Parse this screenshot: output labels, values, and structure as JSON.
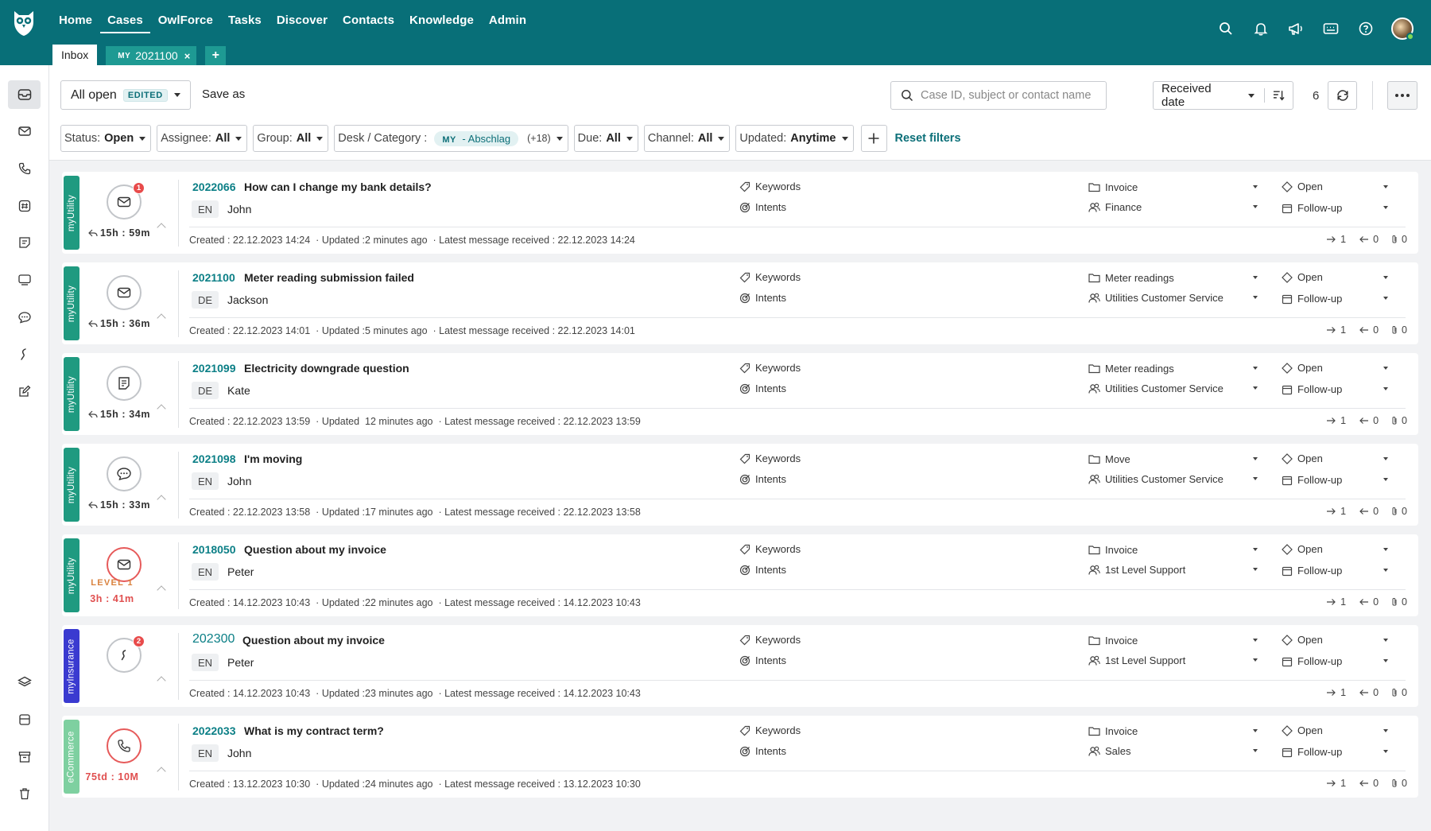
{
  "nav": [
    "Home",
    "Cases",
    "OwlForce",
    "Tasks",
    "Discover",
    "Contacts",
    "Knowledge",
    "Admin"
  ],
  "active_nav": "Cases",
  "tabs": {
    "inbox": "Inbox",
    "case_prefix": "MY",
    "case_id": "2021100",
    "close": "×",
    "add": "+"
  },
  "toolbar": {
    "view_name": "All open",
    "edited": "EDITED",
    "save_as": "Save as",
    "search_placeholder": "Case ID, subject or contact name",
    "sort_label": "Received date",
    "count": "6"
  },
  "filters": [
    {
      "label": "Status:",
      "value": "Open"
    },
    {
      "label": "Assignee:",
      "value": "All"
    },
    {
      "label": "Group:",
      "value": "All"
    },
    {
      "label": "Desk / Category :",
      "chip_prefix": "MY",
      "chip": " - Abschlag",
      "extra": "(+18)"
    },
    {
      "label": "Due:",
      "value": "All"
    },
    {
      "label": "Channel:",
      "value": "All"
    },
    {
      "label": "Updated:",
      "value": "Anytime"
    }
  ],
  "reset_filters": "Reset filters",
  "labels": {
    "keywords": "Keywords",
    "intents": "Intents",
    "created": "Created : ",
    "updated": "Updated",
    "latest": "Latest message received : "
  },
  "brand_colors": {
    "myUtility": "#1f9a80",
    "myInsurance": "#3a3ad0",
    "eCommerce": "#7ed0a0"
  },
  "cases": [
    {
      "brand": "myUtility",
      "channel": "email",
      "badge": "1",
      "sla": "15h : 59m",
      "sla_red": false,
      "level": "",
      "id": "2022066",
      "big": false,
      "subject": "How can I change my bank details?",
      "lang": "EN",
      "contact": "John",
      "category": "Invoice",
      "group": "Finance",
      "status": "Open",
      "followup": "Follow-up",
      "created": "22.12.2023 14:24",
      "updated": " :2 minutes ago",
      "latest": "22.12.2023 14:24",
      "out": "1",
      "in": "0",
      "att": "0"
    },
    {
      "brand": "myUtility",
      "channel": "email",
      "badge": "",
      "sla": "15h : 36m",
      "sla_red": false,
      "level": "",
      "id": "2021100",
      "big": false,
      "subject": "Meter reading submission failed",
      "lang": "DE",
      "contact": "Jackson",
      "category": "Meter readings",
      "group": "Utilities Customer Service",
      "status": "Open",
      "followup": "Follow-up",
      "created": "22.12.2023 14:01",
      "updated": " :5 minutes ago",
      "latest": "22.12.2023 14:01",
      "out": "1",
      "in": "0",
      "att": "0"
    },
    {
      "brand": "myUtility",
      "channel": "form",
      "badge": "",
      "sla": "15h : 34m",
      "sla_red": false,
      "level": "",
      "id": "2021099",
      "big": false,
      "subject": "Electricity downgrade question",
      "lang": "DE",
      "contact": "Kate",
      "category": "Meter readings",
      "group": "Utilities Customer Service",
      "status": "Open",
      "followup": "Follow-up",
      "created": "22.12.2023 13:59",
      "updated": "  12 minutes ago",
      "latest": "22.12.2023 13:59",
      "out": "1",
      "in": "0",
      "att": "0"
    },
    {
      "brand": "myUtility",
      "channel": "chat",
      "badge": "",
      "sla": "15h : 33m",
      "sla_red": false,
      "level": "",
      "id": "2021098",
      "big": false,
      "subject": "I'm moving",
      "lang": "EN",
      "contact": "John",
      "category": "Move",
      "group": "Utilities Customer Service",
      "status": "Open",
      "followup": "Follow-up",
      "created": "22.12.2023 13:58",
      "updated": " :17 minutes ago",
      "latest": "22.12.2023 13:58",
      "out": "1",
      "in": "0",
      "att": "0"
    },
    {
      "brand": "myUtility",
      "channel": "email",
      "badge": "",
      "sla": "3h : 41m",
      "sla_red": true,
      "level": "LEVEL 1",
      "id": "2018050",
      "big": false,
      "subject": "Question about my invoice",
      "lang": "EN",
      "contact": "Peter",
      "category": "Invoice",
      "group": "1st Level Support",
      "status": "Open",
      "followup": "Follow-up",
      "created": "14.12.2023 10:43",
      "updated": " :22 minutes ago",
      "latest": "14.12.2023 10:43",
      "out": "1",
      "in": "0",
      "att": "0"
    },
    {
      "brand": "myInsurance",
      "channel": "whatsapp",
      "badge": "2",
      "sla": "",
      "sla_red": false,
      "level": "",
      "id": "202300",
      "big": true,
      "subject": "Question about my invoice",
      "lang": "EN",
      "contact": "Peter",
      "category": "Invoice",
      "group": "1st Level Support",
      "status": "Open",
      "followup": "Follow-up",
      "created": "14.12.2023 10:43",
      "updated": " :23 minutes ago",
      "latest": "14.12.2023 10:43",
      "out": "1",
      "in": "0",
      "att": "0"
    },
    {
      "brand": "eCommerce",
      "channel": "phone",
      "badge": "",
      "sla": "75td : 10M",
      "sla_red": true,
      "level": "",
      "id": "2022033",
      "big": false,
      "subject": "What is my contract term?",
      "lang": "EN",
      "contact": "John",
      "category": "Invoice",
      "group": "Sales",
      "status": "Open",
      "followup": "Follow-up",
      "created": "13.12.2023 10:30",
      "updated": " :24 minutes ago",
      "latest": "13.12.2023 10:30",
      "out": "1",
      "in": "0",
      "att": "0"
    }
  ]
}
